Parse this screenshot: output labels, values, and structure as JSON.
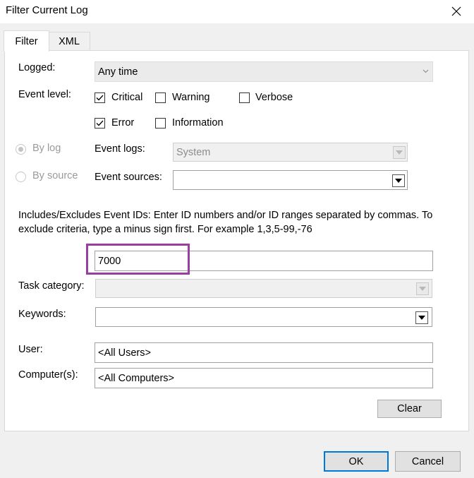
{
  "window": {
    "title": "Filter Current Log"
  },
  "tabs": [
    {
      "label": "Filter"
    },
    {
      "label": "XML"
    }
  ],
  "logged": {
    "label": "Logged:",
    "value": "Any time"
  },
  "event_level": {
    "label": "Event level:",
    "critical": {
      "label": "Critical",
      "checked": true
    },
    "warning": {
      "label": "Warning",
      "checked": false
    },
    "verbose": {
      "label": "Verbose",
      "checked": false
    },
    "error": {
      "label": "Error",
      "checked": true
    },
    "information": {
      "label": "Information",
      "checked": false
    }
  },
  "by_log": {
    "label": "By log",
    "selected": true,
    "enabled": false
  },
  "by_source": {
    "label": "By source",
    "selected": false,
    "enabled": false
  },
  "event_logs": {
    "label": "Event logs:",
    "value": "System"
  },
  "event_sources": {
    "label": "Event sources:",
    "value": ""
  },
  "event_ids": {
    "description": "Includes/Excludes Event IDs: Enter ID numbers and/or ID ranges separated by commas. To exclude criteria, type a minus sign first. For example 1,3,5-99,-76",
    "value": "7000"
  },
  "task_category": {
    "label": "Task category:",
    "value": ""
  },
  "keywords": {
    "label": "Keywords:",
    "value": ""
  },
  "user": {
    "label": "User:",
    "value": "<All Users>"
  },
  "computers": {
    "label": "Computer(s):",
    "value": "<All Computers>"
  },
  "buttons": {
    "clear": "Clear",
    "ok": "OK",
    "cancel": "Cancel"
  },
  "colors": {
    "highlight": "#9b3ea1",
    "default_button_border": "#0078d7"
  }
}
